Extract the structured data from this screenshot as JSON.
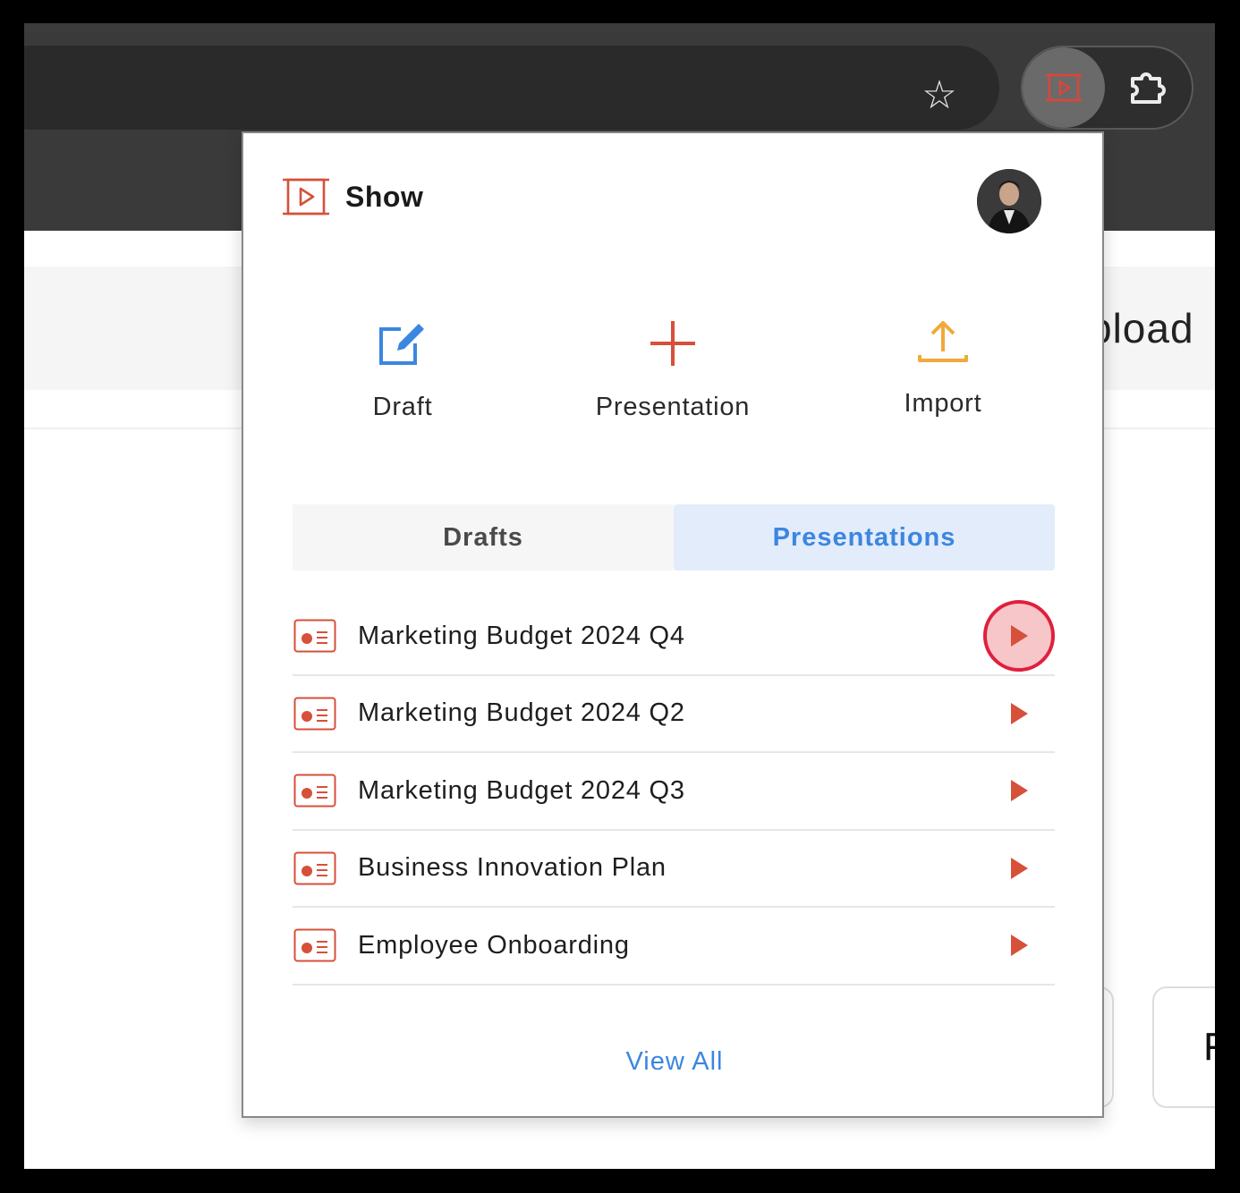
{
  "browser": {
    "bookmark_icon": "star-icon",
    "extension_icon": "show-extension-icon",
    "extensions_menu_icon": "puzzle-icon"
  },
  "background_page": {
    "upload_text": "pload",
    "card_letter": "F"
  },
  "popup": {
    "brand": {
      "name": "Show",
      "icon": "show-logo-icon"
    },
    "actions": [
      {
        "label": "Draft",
        "icon": "edit-icon",
        "color": "#3b86e0"
      },
      {
        "label": "Presentation",
        "icon": "plus-icon",
        "color": "#d6503a"
      },
      {
        "label": "Import",
        "icon": "upload-icon",
        "color": "#f0a93a"
      }
    ],
    "tabs": [
      {
        "label": "Drafts",
        "active": false
      },
      {
        "label": "Presentations",
        "active": true
      }
    ],
    "items": [
      {
        "title": "Marketing Budget 2024 Q4",
        "highlighted": true
      },
      {
        "title": "Marketing Budget 2024 Q2",
        "highlighted": false
      },
      {
        "title": "Marketing Budget 2024 Q3",
        "highlighted": false
      },
      {
        "title": "Business Innovation Plan",
        "highlighted": false
      },
      {
        "title": "Employee Onboarding",
        "highlighted": false
      }
    ],
    "view_all": "View All"
  },
  "colors": {
    "accent_blue": "#3b86e0",
    "brand_red": "#d6503a",
    "import_orange": "#f0a93a",
    "highlight_ring": "#e0203c"
  }
}
